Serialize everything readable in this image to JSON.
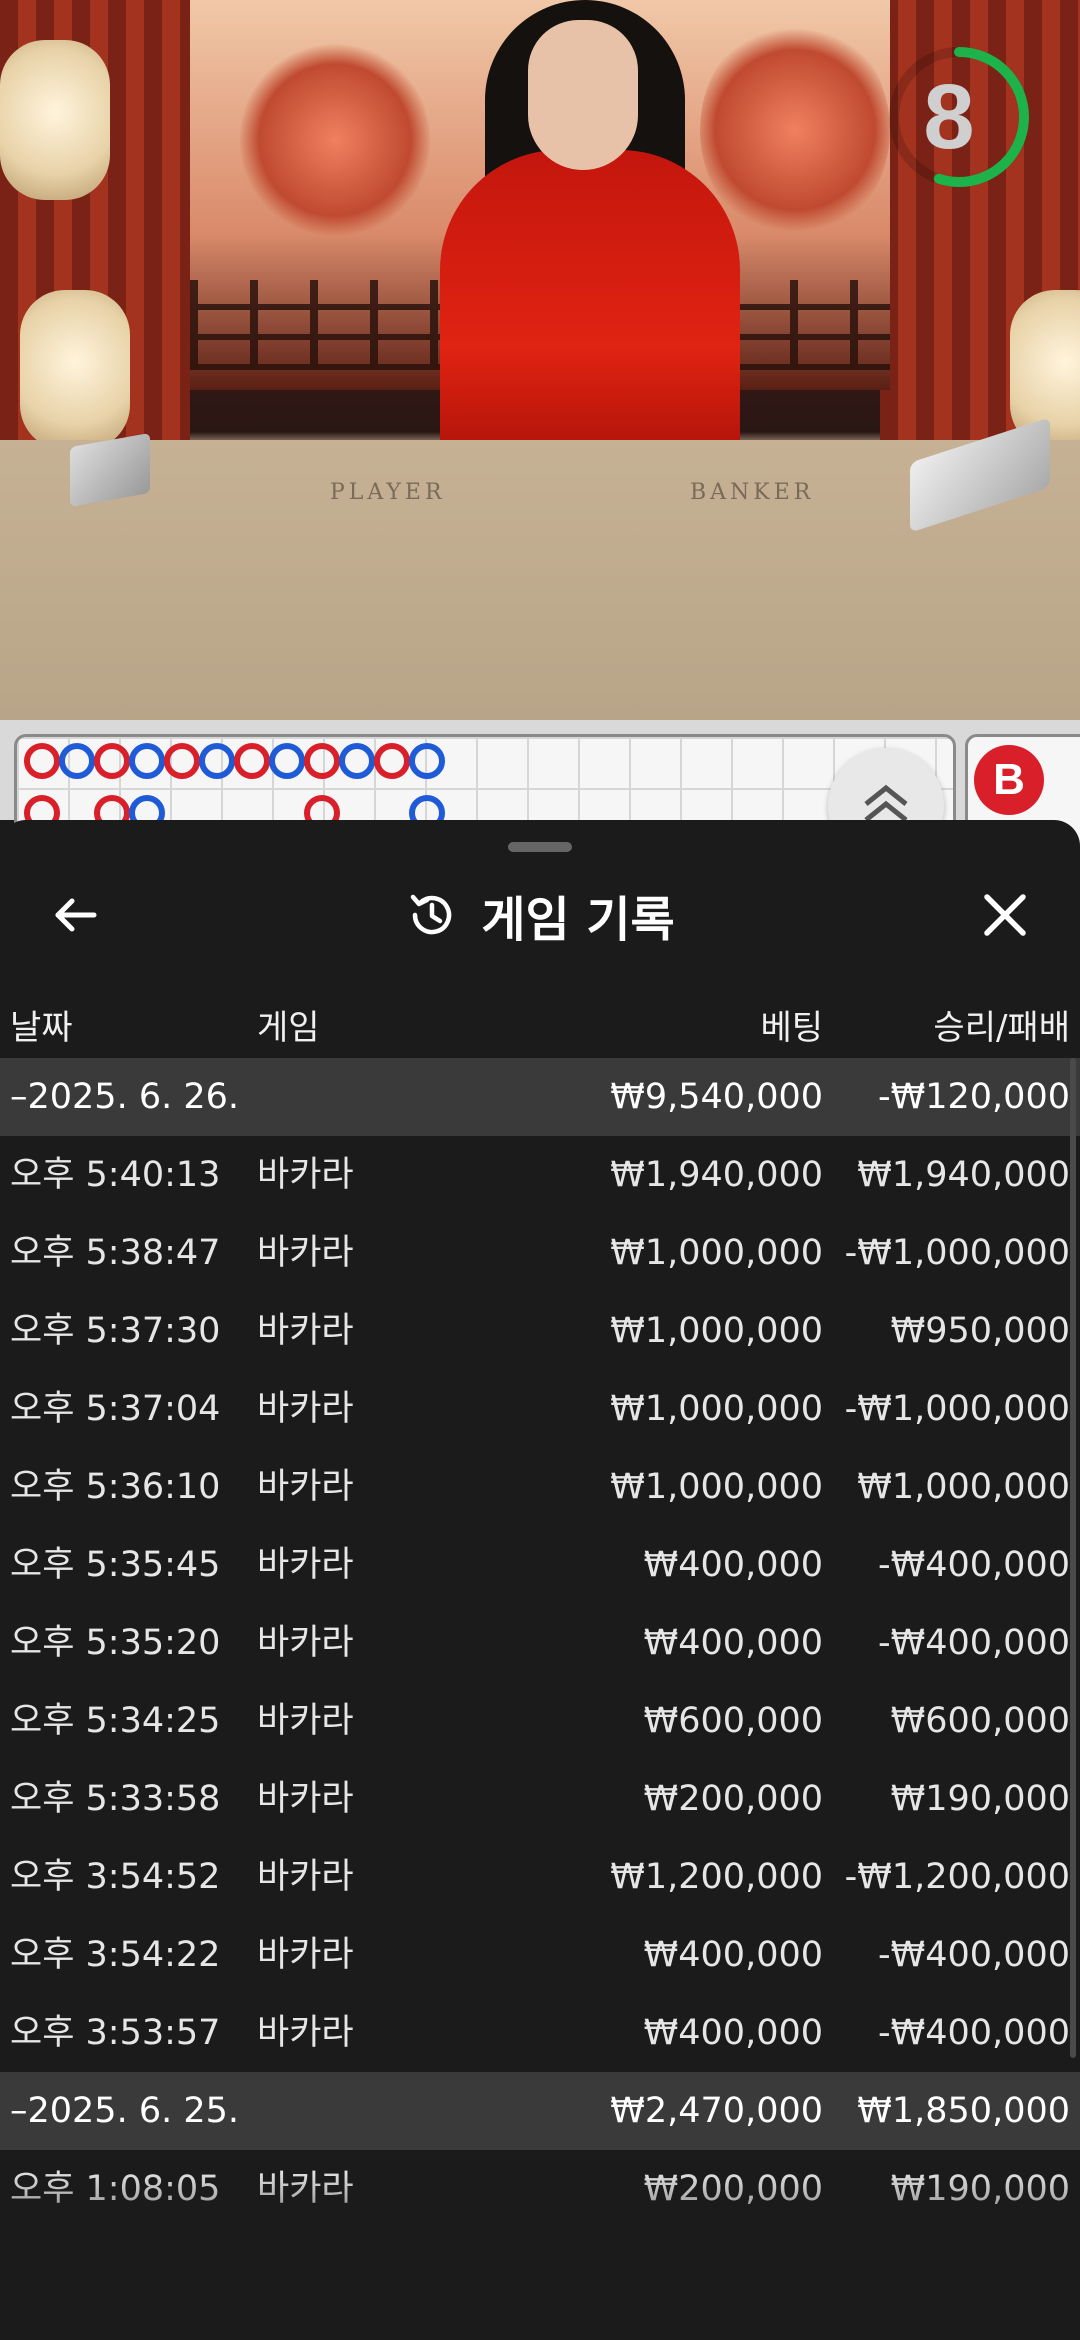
{
  "video": {
    "timer_value": "8",
    "timer_progress": 0.55,
    "felt_player": "PLAYER",
    "felt_banker": "BANKER"
  },
  "roadmap": {
    "beads_row1": [
      "red",
      "blue",
      "red",
      "blue",
      "red",
      "blue",
      "red",
      "blue",
      "red",
      "blue",
      "red",
      "blue"
    ],
    "beads_row2": [
      "red",
      "",
      "red",
      "blue",
      "",
      "",
      "",
      "",
      "red",
      "",
      "",
      "blue"
    ],
    "side_badge": "B"
  },
  "sheet": {
    "title": "게임 기록",
    "back_icon": "arrow-left-icon",
    "history_icon": "history-icon",
    "close_icon": "close-icon",
    "columns": {
      "date": "날짜",
      "game": "게임",
      "bet": "베팅",
      "winloss": "승리/패배"
    },
    "groups": [
      {
        "date": "–2025. 6. 26.",
        "bet": "₩9,540,000",
        "winloss": "-₩120,000",
        "rows": [
          {
            "time": "오후 5:40:13",
            "game": "바카라",
            "bet": "₩1,940,000",
            "winloss": "₩1,940,000"
          },
          {
            "time": "오후 5:38:47",
            "game": "바카라",
            "bet": "₩1,000,000",
            "winloss": "-₩1,000,000"
          },
          {
            "time": "오후 5:37:30",
            "game": "바카라",
            "bet": "₩1,000,000",
            "winloss": "₩950,000"
          },
          {
            "time": "오후 5:37:04",
            "game": "바카라",
            "bet": "₩1,000,000",
            "winloss": "-₩1,000,000"
          },
          {
            "time": "오후 5:36:10",
            "game": "바카라",
            "bet": "₩1,000,000",
            "winloss": "₩1,000,000"
          },
          {
            "time": "오후 5:35:45",
            "game": "바카라",
            "bet": "₩400,000",
            "winloss": "-₩400,000"
          },
          {
            "time": "오후 5:35:20",
            "game": "바카라",
            "bet": "₩400,000",
            "winloss": "-₩400,000"
          },
          {
            "time": "오후 5:34:25",
            "game": "바카라",
            "bet": "₩600,000",
            "winloss": "₩600,000"
          },
          {
            "time": "오후 5:33:58",
            "game": "바카라",
            "bet": "₩200,000",
            "winloss": "₩190,000"
          },
          {
            "time": "오후 3:54:52",
            "game": "바카라",
            "bet": "₩1,200,000",
            "winloss": "-₩1,200,000"
          },
          {
            "time": "오후 3:54:22",
            "game": "바카라",
            "bet": "₩400,000",
            "winloss": "-₩400,000"
          },
          {
            "time": "오후 3:53:57",
            "game": "바카라",
            "bet": "₩400,000",
            "winloss": "-₩400,000"
          }
        ]
      },
      {
        "date": "–2025. 6. 25.",
        "bet": "₩2,470,000",
        "winloss": "₩1,850,000",
        "rows": [
          {
            "time": "오후 1:08:05",
            "game": "바카라",
            "bet": "₩200,000",
            "winloss": "₩190,000"
          }
        ]
      }
    ]
  }
}
